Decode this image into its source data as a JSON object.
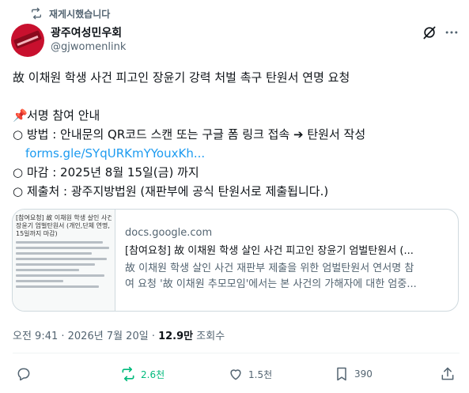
{
  "repost": {
    "label": "재게시했습니다"
  },
  "author": {
    "name": "광주여성민우회",
    "handle": "@gjwomenlink"
  },
  "post": {
    "line1": "故 이채원 학생 사건 피고인 장윤기 강력 처벌 촉구 탄원서 연명 요청",
    "section_title": "서명 참여 안내",
    "method": "○ 방법 : 안내문의 QR코드 스캔 또는 구글 폼 링크 접속 ➔ 탄원서 작성",
    "link": "forms.gle/SYqURKmYYouxKh...",
    "deadline": "○ 마감 : 2025년 8월 15일(금) 까지",
    "submit": "○ 제출처 : 광주지방법원 (재판부에 공식 탄원서로 제출됩니다.)"
  },
  "card": {
    "thumb_title_1": "[참여요청] 故 이채원 학생 살인 사건 피고",
    "thumb_title_2": "장윤기 엄벌탄원서 (개인,단체 연명, 8",
    "thumb_title_3": "15일까지 마감)",
    "domain": "docs.google.com",
    "title": "[참여요청] 故 이채원 학생 살인 사건 피고인 장윤기 엄벌탄원서 (...",
    "desc1": "故 이채원 학생 살인 사건 재판부 제출을 위한 엄벌탄원서 연서명 참",
    "desc2": "여 요청 '故 이채원 추모모임'에서는 본 사건의 가해자에 대한 엄중..."
  },
  "meta": {
    "time": "오전 9:41 · 2026년 7월 20일 · ",
    "views": "12.9만",
    "views_label": " 조회수"
  },
  "actions": {
    "reply": "",
    "retweets": "2.6천",
    "likes": "1.5천",
    "bookmarks": "390"
  },
  "colors": {
    "link": "#1d9bf0",
    "retweet": "#00ba7c",
    "muted": "#536471",
    "avatar": "#c8102e"
  }
}
